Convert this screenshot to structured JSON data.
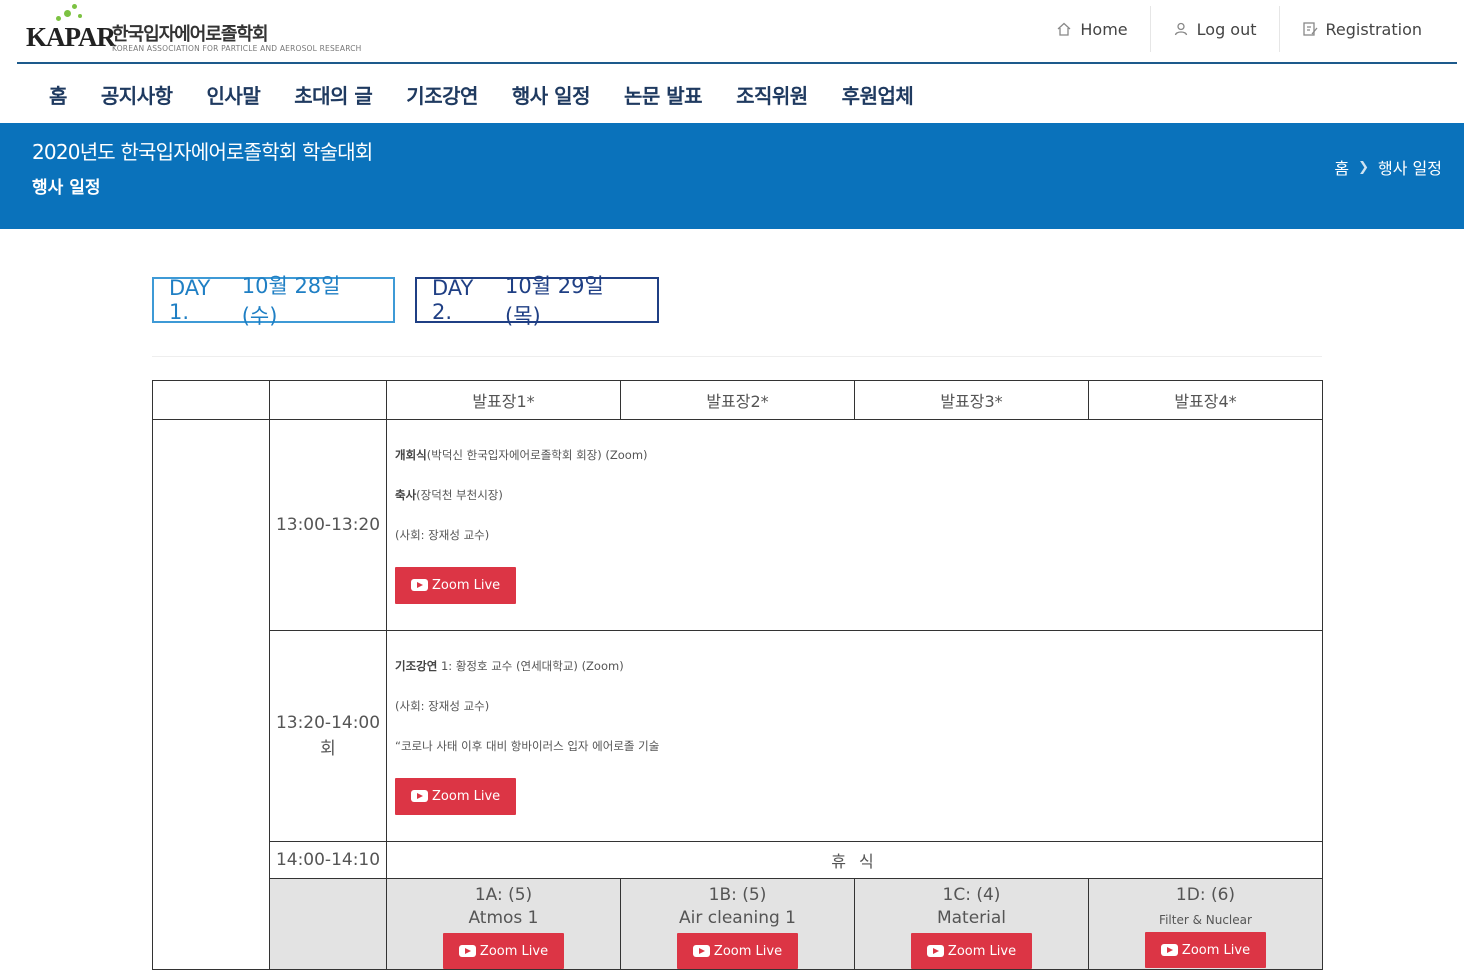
{
  "header": {
    "logo_text": "KAPAR",
    "logo_kr": "한국입자에어로졸학회",
    "logo_en": "KOREAN ASSOCIATION FOR PARTICLE AND AEROSOL RESEARCH",
    "util": [
      {
        "label": "Home",
        "icon": "home-icon"
      },
      {
        "label": "Log out",
        "icon": "user-icon"
      },
      {
        "label": "Registration",
        "icon": "edit-icon"
      }
    ],
    "accent": "#1d5a8c"
  },
  "nav": [
    "홈",
    "공지사항",
    "인사말",
    "초대의 글",
    "기조강연",
    "행사 일정",
    "논문 발표",
    "조직위원",
    "후원업체"
  ],
  "banner": {
    "title": "2020년도 한국입자에어로졸학회 학술대회",
    "subtitle": "행사 일정",
    "breadcrumb": [
      "홈",
      "행사 일정"
    ],
    "color": "#0a72bb"
  },
  "days": [
    {
      "day": "DAY 1.",
      "date": "10월 28일 (수)"
    },
    {
      "day": "DAY 2.",
      "date": "10월 29일 (목)"
    }
  ],
  "schedule": {
    "halls": [
      "발표장1*",
      "발표장2*",
      "발표장3*",
      "발표장4*"
    ],
    "rows": [
      {
        "time": "13:00-13:20",
        "lines": [
          {
            "bold": "개회식",
            "text": "(박덕신 한국입자에어로졸학회 회장) (Zoom)"
          },
          {
            "bold": "축사",
            "text": "(장덕천 부천시장)"
          },
          {
            "bold": "",
            "text": "(사회: 장재성 교수)"
          }
        ],
        "button": "Zoom Live"
      },
      {
        "time": "13:20-14:00",
        "time2": "회",
        "lines": [
          {
            "bold": "기조강연",
            "text": " 1: 황정호 교수 (연세대학교) (Zoom)"
          },
          {
            "bold": "",
            "text": "(사회: 장재성 교수)"
          },
          {
            "bold": "",
            "text": "“코로나 사태 이후 대비 항바이러스 입자 에어로졸 기술"
          }
        ],
        "button": "Zoom Live"
      }
    ],
    "break_time": "14:00-14:10",
    "break_label": "휴 식",
    "sessions": [
      {
        "code": "1A:",
        "count": "(5)",
        "name": "Atmos 1",
        "button": "Zoom Live"
      },
      {
        "code": "1B:",
        "count": "(5)",
        "name": "Air cleaning 1",
        "button": "Zoom Live"
      },
      {
        "code": "1C:",
        "count": "(4)",
        "name": "Material",
        "button": "Zoom Live"
      },
      {
        "code": "1D:",
        "count": "(6)",
        "name": "Filter & Nuclear",
        "button": "Zoom Live"
      }
    ]
  }
}
